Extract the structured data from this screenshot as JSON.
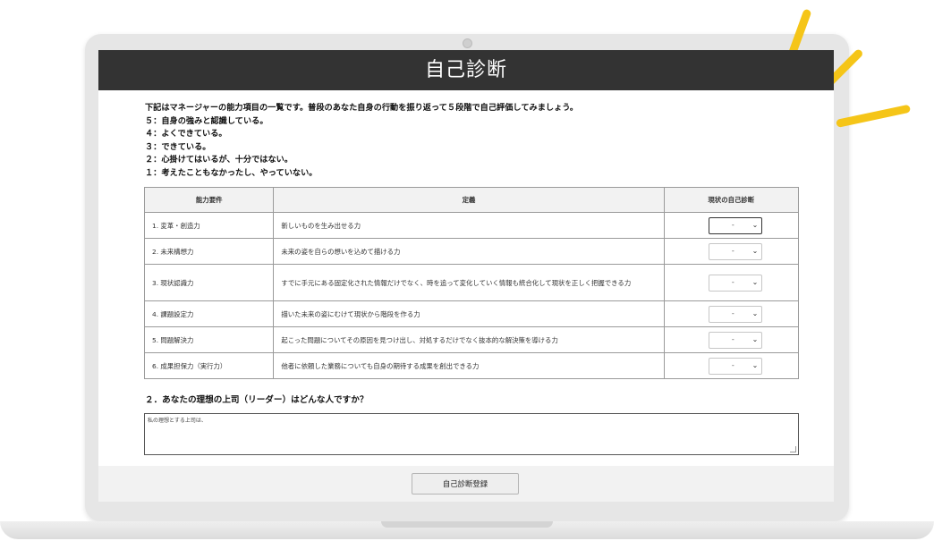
{
  "page": {
    "title": "自己診断"
  },
  "intro": {
    "lines": [
      "下記はマネージャーの能力項目の一覧です。普段のあなた自身の行動を振り返って５段階で自己評価してみましょう。",
      "５：自身の強みと認識している。",
      "４：よくできている。",
      "３：できている。",
      "２：心掛けてはいるが、十分ではない。",
      "１：考えたこともなかったし、やっていない。"
    ]
  },
  "table": {
    "headers": [
      "能力要件",
      "定義",
      "現状の自己診断"
    ],
    "rows": [
      {
        "name": "1. 変革・創造力",
        "definition": "新しいものを生み出せる力",
        "value": "-"
      },
      {
        "name": "2. 未来構想力",
        "definition": "未来の姿を自らの想いを込めて描ける力",
        "value": "-"
      },
      {
        "name": "3. 現状認識力",
        "definition": "すでに手元にある固定化された情報だけでなく、時を追って変化していく情報も統合化して現状を正しく把握できる力",
        "value": "-"
      },
      {
        "name": "4. 課題設定力",
        "definition": "描いた未来の姿にむけて現状から階段を作る力",
        "value": "-"
      },
      {
        "name": "5. 問題解決力",
        "definition": "起こった問題についてその原因を見つけ出し、対処するだけでなく抜本的な解決策を導ける力",
        "value": "-"
      },
      {
        "name": "6. 成果担保力（実行力）",
        "definition": "他者に依頼した業務についても自身の期待する成果を創出できる力",
        "value": "-"
      }
    ]
  },
  "question": {
    "label": "２．あなたの理想の上司（リーダー）はどんな人ですか？",
    "answer_value": "私の理想とする上司は、"
  },
  "actions": {
    "submit_label": "自己診断登録"
  },
  "colors": {
    "header_bg": "#333333",
    "accent_yellow": "#f5c518"
  },
  "icons": {
    "select_arrow": "chevron-down-icon"
  }
}
